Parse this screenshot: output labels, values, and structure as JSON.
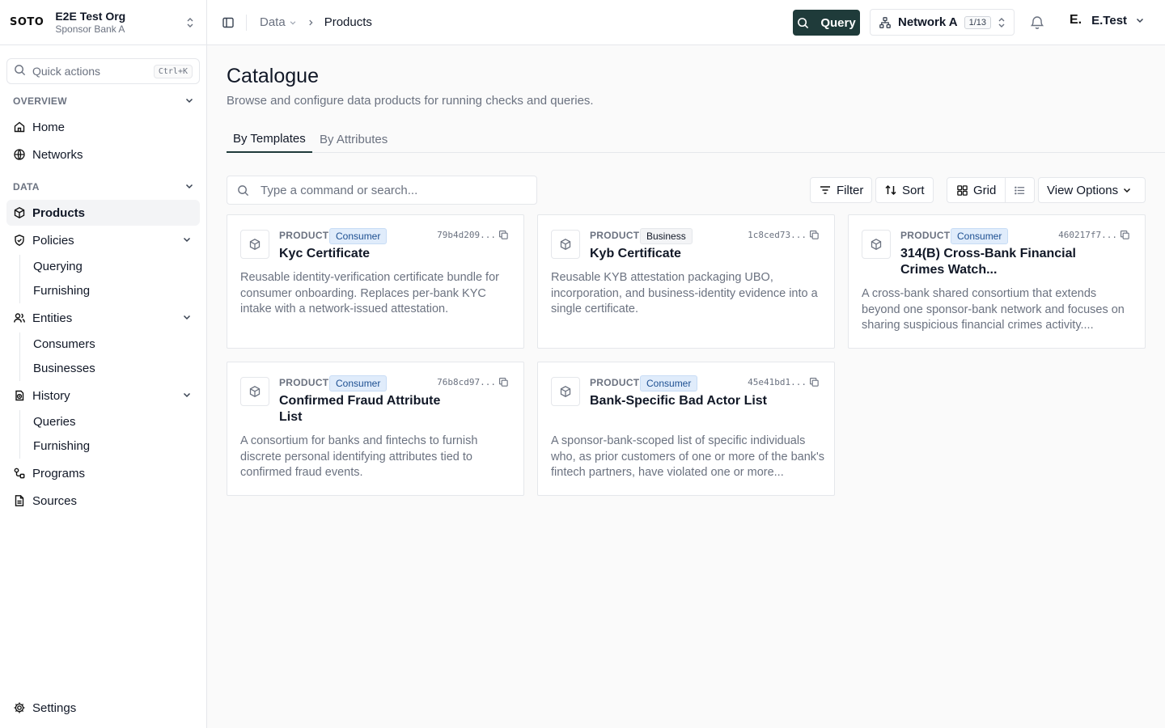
{
  "org": {
    "logo": "SOTO",
    "name": "E2E Test Org",
    "subtitle": "Sponsor Bank A"
  },
  "quick_actions": {
    "label": "Quick actions",
    "shortcut": "Ctrl+K"
  },
  "sidebar": {
    "overview_label": "OVERVIEW",
    "data_label": "DATA",
    "home": "Home",
    "networks": "Networks",
    "products": "Products",
    "policies": "Policies",
    "policies_sub": [
      "Querying",
      "Furnishing"
    ],
    "entities": "Entities",
    "entities_sub": [
      "Consumers",
      "Businesses"
    ],
    "history": "History",
    "history_sub": [
      "Queries",
      "Furnishing"
    ],
    "programs": "Programs",
    "sources": "Sources",
    "settings": "Settings"
  },
  "topbar": {
    "breadcrumb_parent": "Data",
    "breadcrumb_current": "Products",
    "query_label": "Query",
    "network_name": "Network A",
    "network_count": "1/13",
    "user_initial": "E.",
    "user_name": "E.Test"
  },
  "page": {
    "title": "Catalogue",
    "subtitle": "Browse and configure data products for running checks and queries.",
    "tabs": [
      "By Templates",
      "By Attributes"
    ]
  },
  "toolbar": {
    "search_placeholder": "Type a command or search...",
    "filter_label": "Filter",
    "sort_label": "Sort",
    "grid_label": "Grid",
    "view_options_label": "View Options"
  },
  "cards": [
    {
      "kind": "PRODUCT",
      "badge": "Consumer",
      "id": "79b4d209...",
      "title": "Kyc Certificate",
      "description": "Reusable identity-verification certificate bundle for consumer onboarding. Replaces per-bank KYC intake with a network-issued attestation."
    },
    {
      "kind": "PRODUCT",
      "badge": "Business",
      "id": "1c8ced73...",
      "title": "Kyb Certificate",
      "description": "Reusable KYB attestation packaging UBO, incorporation, and business-identity evidence into a single certificate."
    },
    {
      "kind": "PRODUCT",
      "badge": "Consumer",
      "id": "460217f7...",
      "title": "314(B) Cross-Bank Financial Crimes Watch...",
      "description": "A cross-bank shared consortium that extends beyond one sponsor-bank network and focuses on sharing suspicious financial crimes activity...."
    },
    {
      "kind": "PRODUCT",
      "badge": "Consumer",
      "id": "76b8cd97...",
      "title": "Confirmed Fraud Attribute List",
      "description": "A consortium for banks and fintechs to furnish discrete personal identifying attributes tied to confirmed fraud events."
    },
    {
      "kind": "PRODUCT",
      "badge": "Consumer",
      "id": "45e41bd1...",
      "title": "Bank-Specific Bad Actor List",
      "description": "A sponsor-bank-scoped list of specific individuals who, as prior customers of one or more of the bank's fintech partners, have violated one or more..."
    }
  ]
}
